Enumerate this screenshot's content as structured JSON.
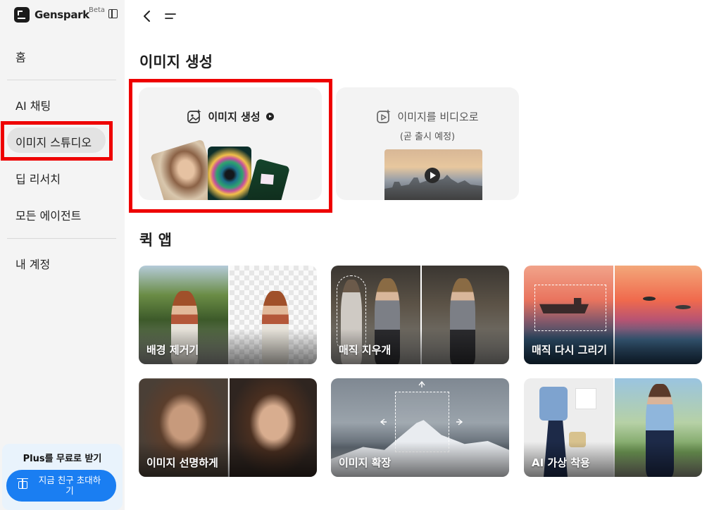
{
  "brand": {
    "name": "Genspark",
    "badge": "Beta"
  },
  "sidebar": {
    "items": [
      {
        "label": "홈"
      },
      {
        "label": "AI 채팅"
      },
      {
        "label": "이미지 스튜디오"
      },
      {
        "label": "딥 리서치"
      },
      {
        "label": "모든 에이전트"
      },
      {
        "label": "내 계정"
      }
    ],
    "promo": {
      "title": "Plus를 무료로 받기",
      "button": "지금 친구 초대하\n기"
    }
  },
  "main": {
    "section_image": "이미지 생성",
    "cards": [
      {
        "title": "이미지 생성"
      },
      {
        "title": "이미지를 비디오로",
        "subtitle": "(곧 출시 예정)"
      }
    ],
    "section_quick": "퀵 앱",
    "apps": [
      {
        "label": "배경 제거기"
      },
      {
        "label": "매직 지우개"
      },
      {
        "label": "매직 다시 그리기"
      },
      {
        "label": "이미지 선명하게"
      },
      {
        "label": "이미지 확장"
      },
      {
        "label": "AI 가상 착용"
      }
    ]
  },
  "colors": {
    "highlight": "#ee0000",
    "invite_button": "#1a7ef2",
    "sidebar_bg": "#f4f4f4"
  },
  "icons": [
    "sidebar-toggle-icon",
    "back-icon",
    "menu-icon",
    "image-generate-icon",
    "video-generate-icon",
    "gift-icon",
    "play-icon",
    "arrow-right-icon"
  ]
}
